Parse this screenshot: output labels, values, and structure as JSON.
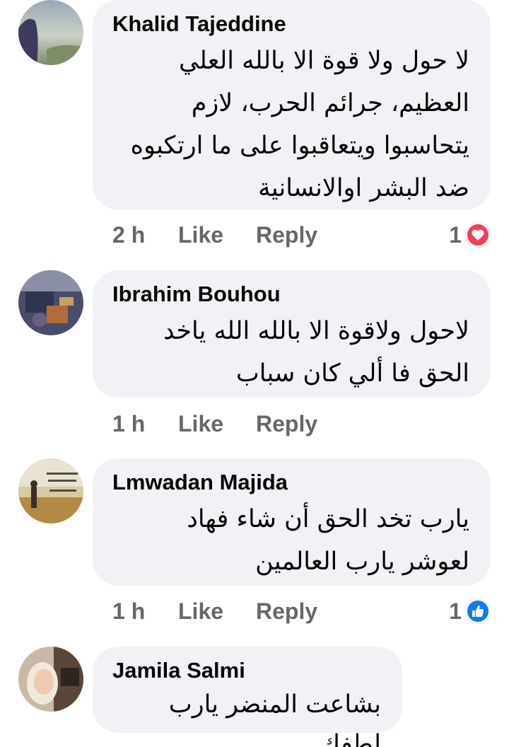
{
  "colors": {
    "bubble": "#f0f2f5",
    "meta_text": "#65676b",
    "love_reaction": "#f33e58",
    "like_reaction": "#1877f2"
  },
  "comments": [
    {
      "author": "Khalid Tajeddine",
      "text": "لا حول ولا قوة الا بالله العلي العظيم، جرائم الحرب، لازم يتحاسبوا ويتعاقبوا على ما ارتكبوه ضد البشر اوالانسانية",
      "time": "2 h",
      "like_label": "Like",
      "reply_label": "Reply",
      "reaction_count": "1",
      "reaction_icon": "heart-icon"
    },
    {
      "author": "Ibrahim Bouhou",
      "text": "لاحول ولاقوة الا بالله الله ياخد الحق فا ألي كان سباب",
      "time": "1 h",
      "like_label": "Like",
      "reply_label": "Reply"
    },
    {
      "author": "Lmwadan Majida",
      "text": "يارب تخد الحق أن شاء فهاد لعوشر يارب العالمين",
      "time": "1 h",
      "like_label": "Like",
      "reply_label": "Reply",
      "reaction_count": "1",
      "reaction_icon": "thumbs-up-icon"
    },
    {
      "author": "Jamila Salmi",
      "text": "بشاعت المنضر يارب لطفك"
    }
  ]
}
